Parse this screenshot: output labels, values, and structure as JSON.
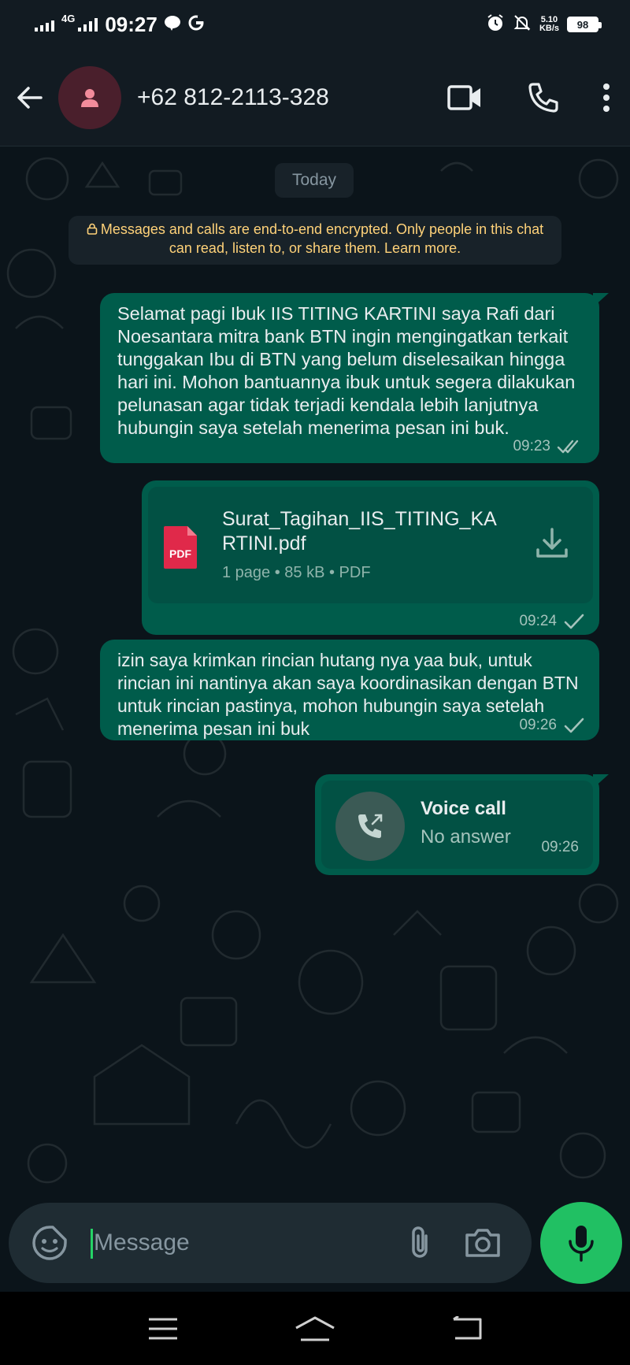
{
  "status_bar": {
    "network": "4G",
    "time": "09:27",
    "net_speed_value": "5.10",
    "net_speed_unit": "KB/s",
    "battery": "98"
  },
  "header": {
    "contact": "+62 812-2113-328",
    "icons": [
      "back-arrow-icon",
      "avatar-person-icon",
      "video-call-icon",
      "phone-icon",
      "more-vert-icon"
    ]
  },
  "chat": {
    "date_chip": "Today",
    "encryption_notice": "Messages and calls are end-to-end encrypted. Only people in this chat can read, listen to, or share them. Learn more.",
    "messages": [
      {
        "text": "Selamat pagi Ibuk IIS TITING KARTINI saya Rafi dari Noesantara mitra bank BTN ingin mengingatkan terkait tunggakan Ibu di BTN yang belum diselesaikan hingga hari ini. Mohon bantuannya ibuk untuk segera dilakukan pelunasan agar tidak terjadi kendala lebih lanjutnya hubungin saya setelah menerima pesan ini buk.",
        "time": "09:23",
        "status": "read"
      },
      {
        "doc_name": "Surat_Tagihan_IIS_TITING_KARTINI.pdf",
        "doc_info": "1 page • 85 kB • PDF",
        "pdf_badge": "PDF",
        "time": "09:24",
        "status": "sent"
      },
      {
        "text": "izin saya krimkan rincian hutang nya yaa buk, untuk rincian ini nantinya akan saya koordinasikan dengan BTN untuk rincian pastinya, mohon hubungin saya setelah menerima pesan ini buk",
        "time": "09:26",
        "status": "sent"
      },
      {
        "call_title": "Voice call",
        "call_status": "No answer",
        "time": "09:26"
      }
    ]
  },
  "composer": {
    "placeholder": "Message",
    "icons": [
      "sticker-icon",
      "attach-icon",
      "camera-icon",
      "mic-icon"
    ]
  },
  "colors": {
    "bubble_out": "#005c4b",
    "background": "#0b141a",
    "accent": "#21c063",
    "notice_text": "#ffd279"
  }
}
